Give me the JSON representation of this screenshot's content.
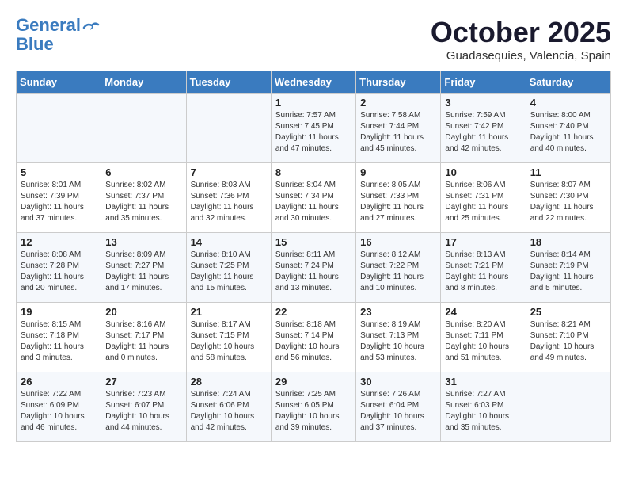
{
  "header": {
    "logo_line1": "General",
    "logo_line2": "Blue",
    "month": "October 2025",
    "location": "Guadasequies, Valencia, Spain"
  },
  "days_of_week": [
    "Sunday",
    "Monday",
    "Tuesday",
    "Wednesday",
    "Thursday",
    "Friday",
    "Saturday"
  ],
  "weeks": [
    [
      {
        "day": "",
        "sunrise": "",
        "sunset": "",
        "daylight": ""
      },
      {
        "day": "",
        "sunrise": "",
        "sunset": "",
        "daylight": ""
      },
      {
        "day": "",
        "sunrise": "",
        "sunset": "",
        "daylight": ""
      },
      {
        "day": "1",
        "sunrise": "Sunrise: 7:57 AM",
        "sunset": "Sunset: 7:45 PM",
        "daylight": "Daylight: 11 hours and 47 minutes."
      },
      {
        "day": "2",
        "sunrise": "Sunrise: 7:58 AM",
        "sunset": "Sunset: 7:44 PM",
        "daylight": "Daylight: 11 hours and 45 minutes."
      },
      {
        "day": "3",
        "sunrise": "Sunrise: 7:59 AM",
        "sunset": "Sunset: 7:42 PM",
        "daylight": "Daylight: 11 hours and 42 minutes."
      },
      {
        "day": "4",
        "sunrise": "Sunrise: 8:00 AM",
        "sunset": "Sunset: 7:40 PM",
        "daylight": "Daylight: 11 hours and 40 minutes."
      }
    ],
    [
      {
        "day": "5",
        "sunrise": "Sunrise: 8:01 AM",
        "sunset": "Sunset: 7:39 PM",
        "daylight": "Daylight: 11 hours and 37 minutes."
      },
      {
        "day": "6",
        "sunrise": "Sunrise: 8:02 AM",
        "sunset": "Sunset: 7:37 PM",
        "daylight": "Daylight: 11 hours and 35 minutes."
      },
      {
        "day": "7",
        "sunrise": "Sunrise: 8:03 AM",
        "sunset": "Sunset: 7:36 PM",
        "daylight": "Daylight: 11 hours and 32 minutes."
      },
      {
        "day": "8",
        "sunrise": "Sunrise: 8:04 AM",
        "sunset": "Sunset: 7:34 PM",
        "daylight": "Daylight: 11 hours and 30 minutes."
      },
      {
        "day": "9",
        "sunrise": "Sunrise: 8:05 AM",
        "sunset": "Sunset: 7:33 PM",
        "daylight": "Daylight: 11 hours and 27 minutes."
      },
      {
        "day": "10",
        "sunrise": "Sunrise: 8:06 AM",
        "sunset": "Sunset: 7:31 PM",
        "daylight": "Daylight: 11 hours and 25 minutes."
      },
      {
        "day": "11",
        "sunrise": "Sunrise: 8:07 AM",
        "sunset": "Sunset: 7:30 PM",
        "daylight": "Daylight: 11 hours and 22 minutes."
      }
    ],
    [
      {
        "day": "12",
        "sunrise": "Sunrise: 8:08 AM",
        "sunset": "Sunset: 7:28 PM",
        "daylight": "Daylight: 11 hours and 20 minutes."
      },
      {
        "day": "13",
        "sunrise": "Sunrise: 8:09 AM",
        "sunset": "Sunset: 7:27 PM",
        "daylight": "Daylight: 11 hours and 17 minutes."
      },
      {
        "day": "14",
        "sunrise": "Sunrise: 8:10 AM",
        "sunset": "Sunset: 7:25 PM",
        "daylight": "Daylight: 11 hours and 15 minutes."
      },
      {
        "day": "15",
        "sunrise": "Sunrise: 8:11 AM",
        "sunset": "Sunset: 7:24 PM",
        "daylight": "Daylight: 11 hours and 13 minutes."
      },
      {
        "day": "16",
        "sunrise": "Sunrise: 8:12 AM",
        "sunset": "Sunset: 7:22 PM",
        "daylight": "Daylight: 11 hours and 10 minutes."
      },
      {
        "day": "17",
        "sunrise": "Sunrise: 8:13 AM",
        "sunset": "Sunset: 7:21 PM",
        "daylight": "Daylight: 11 hours and 8 minutes."
      },
      {
        "day": "18",
        "sunrise": "Sunrise: 8:14 AM",
        "sunset": "Sunset: 7:19 PM",
        "daylight": "Daylight: 11 hours and 5 minutes."
      }
    ],
    [
      {
        "day": "19",
        "sunrise": "Sunrise: 8:15 AM",
        "sunset": "Sunset: 7:18 PM",
        "daylight": "Daylight: 11 hours and 3 minutes."
      },
      {
        "day": "20",
        "sunrise": "Sunrise: 8:16 AM",
        "sunset": "Sunset: 7:17 PM",
        "daylight": "Daylight: 11 hours and 0 minutes."
      },
      {
        "day": "21",
        "sunrise": "Sunrise: 8:17 AM",
        "sunset": "Sunset: 7:15 PM",
        "daylight": "Daylight: 10 hours and 58 minutes."
      },
      {
        "day": "22",
        "sunrise": "Sunrise: 8:18 AM",
        "sunset": "Sunset: 7:14 PM",
        "daylight": "Daylight: 10 hours and 56 minutes."
      },
      {
        "day": "23",
        "sunrise": "Sunrise: 8:19 AM",
        "sunset": "Sunset: 7:13 PM",
        "daylight": "Daylight: 10 hours and 53 minutes."
      },
      {
        "day": "24",
        "sunrise": "Sunrise: 8:20 AM",
        "sunset": "Sunset: 7:11 PM",
        "daylight": "Daylight: 10 hours and 51 minutes."
      },
      {
        "day": "25",
        "sunrise": "Sunrise: 8:21 AM",
        "sunset": "Sunset: 7:10 PM",
        "daylight": "Daylight: 10 hours and 49 minutes."
      }
    ],
    [
      {
        "day": "26",
        "sunrise": "Sunrise: 7:22 AM",
        "sunset": "Sunset: 6:09 PM",
        "daylight": "Daylight: 10 hours and 46 minutes."
      },
      {
        "day": "27",
        "sunrise": "Sunrise: 7:23 AM",
        "sunset": "Sunset: 6:07 PM",
        "daylight": "Daylight: 10 hours and 44 minutes."
      },
      {
        "day": "28",
        "sunrise": "Sunrise: 7:24 AM",
        "sunset": "Sunset: 6:06 PM",
        "daylight": "Daylight: 10 hours and 42 minutes."
      },
      {
        "day": "29",
        "sunrise": "Sunrise: 7:25 AM",
        "sunset": "Sunset: 6:05 PM",
        "daylight": "Daylight: 10 hours and 39 minutes."
      },
      {
        "day": "30",
        "sunrise": "Sunrise: 7:26 AM",
        "sunset": "Sunset: 6:04 PM",
        "daylight": "Daylight: 10 hours and 37 minutes."
      },
      {
        "day": "31",
        "sunrise": "Sunrise: 7:27 AM",
        "sunset": "Sunset: 6:03 PM",
        "daylight": "Daylight: 10 hours and 35 minutes."
      },
      {
        "day": "",
        "sunrise": "",
        "sunset": "",
        "daylight": ""
      }
    ]
  ]
}
